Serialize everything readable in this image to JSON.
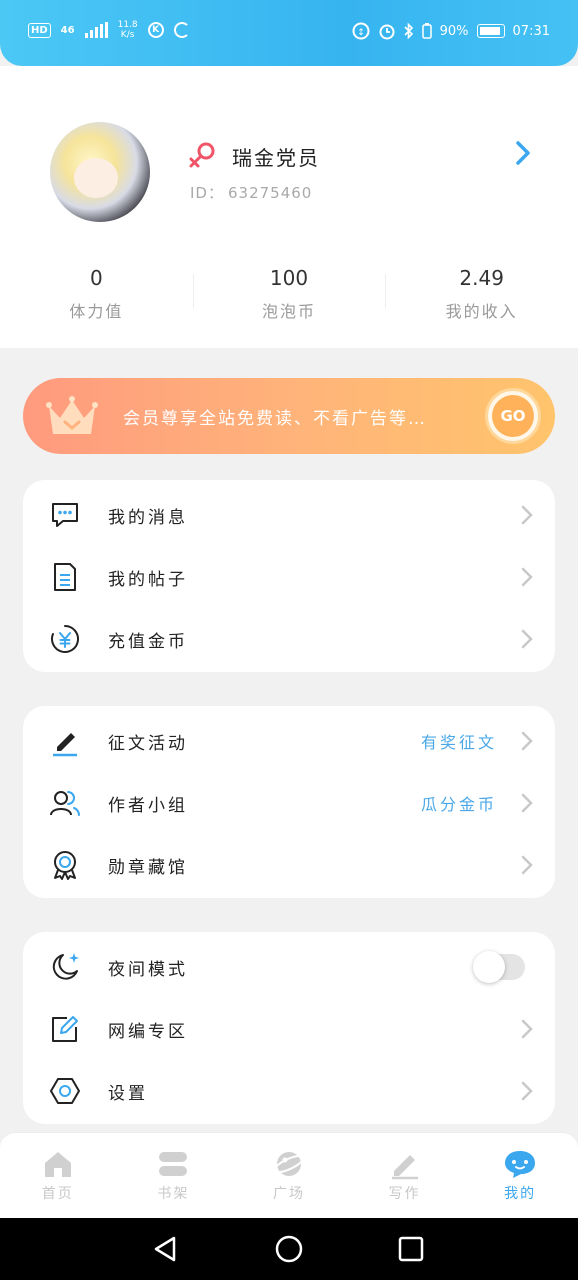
{
  "status_bar": {
    "hd": "HD",
    "network": "46",
    "speed_top": "11.8",
    "speed_bottom": "K/s",
    "circle_icon_letter": "K",
    "battery": "90%",
    "time": "07:31"
  },
  "profile": {
    "username": "瑞金党员",
    "id_label": "ID：",
    "id_value": "63275460",
    "stats": [
      {
        "value": "0",
        "label": "体力值"
      },
      {
        "value": "100",
        "label": "泡泡币"
      },
      {
        "value": "2.49",
        "label": "我的收入"
      }
    ]
  },
  "vip_banner": {
    "text": "会员尊享全站免费读、不看广告等…",
    "go_label": "GO"
  },
  "card1": [
    {
      "icon": "message-icon",
      "label": "我的消息"
    },
    {
      "icon": "document-icon",
      "label": "我的帖子"
    },
    {
      "icon": "coin-icon",
      "label": "充值金币"
    }
  ],
  "card2": [
    {
      "icon": "pen-icon",
      "label": "征文活动",
      "extra": "有奖征文"
    },
    {
      "icon": "group-icon",
      "label": "作者小组",
      "extra": "瓜分金币"
    },
    {
      "icon": "medal-icon",
      "label": "勋章藏馆"
    }
  ],
  "card3": [
    {
      "icon": "moon-icon",
      "label": "夜间模式",
      "toggle": false
    },
    {
      "icon": "edit-icon",
      "label": "网编专区"
    },
    {
      "icon": "settings-icon",
      "label": "设置"
    }
  ],
  "bottom_nav": [
    {
      "icon": "home-icon",
      "label": "首页",
      "active": false
    },
    {
      "icon": "bookshelf-icon",
      "label": "书架",
      "active": false
    },
    {
      "icon": "planet-icon",
      "label": "广场",
      "active": false
    },
    {
      "icon": "write-icon",
      "label": "写作",
      "active": false
    },
    {
      "icon": "chat-bubble-icon",
      "label": "我的",
      "active": true
    }
  ],
  "colors": {
    "accent": "#3aa7ee",
    "status_bar": "#36b4f0",
    "vip_start": "#ff9a7e",
    "vip_end": "#ffc46c"
  }
}
